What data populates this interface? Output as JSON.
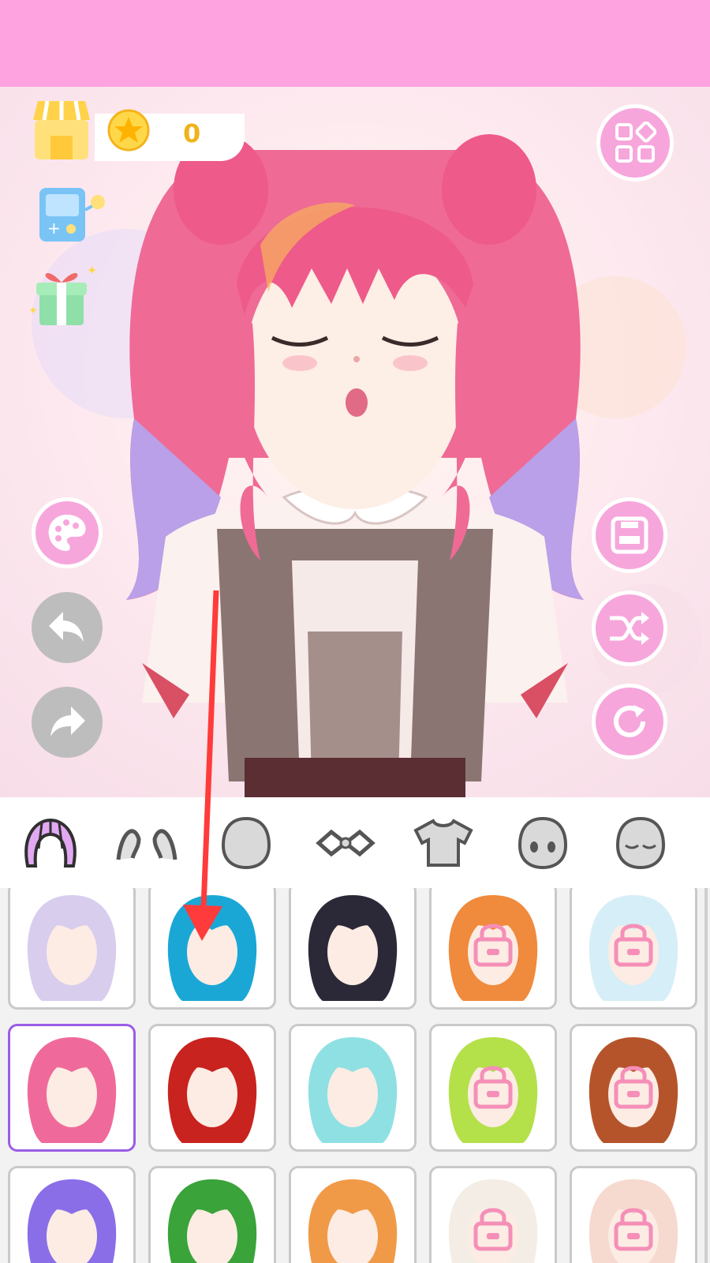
{
  "app": {
    "coins": "0",
    "colors": {
      "topbar": "#ffa3e0",
      "pink_button": "#f7a6dc",
      "grey_button": "#bdbdbd",
      "selected_border": "#9b5de5",
      "hair": "#ef5f8f",
      "annotation_arrow": "#ff3b3b"
    }
  },
  "side_buttons_left": [
    "shop-icon",
    "coin-icon",
    "game-icon",
    "gift-icon",
    "palette-icon",
    "undo-icon",
    "redo-icon"
  ],
  "side_buttons_right": [
    "grid-menu-icon",
    "save-icon",
    "shuffle-icon",
    "refresh-icon"
  ],
  "categories": [
    {
      "name": "hair",
      "icon": "hair-icon",
      "active": true
    },
    {
      "name": "ears",
      "icon": "ears-icon",
      "active": false
    },
    {
      "name": "head",
      "icon": "head-icon",
      "active": false
    },
    {
      "name": "accessory",
      "icon": "accessory-icon",
      "active": false
    },
    {
      "name": "clothes",
      "icon": "shirt-icon",
      "active": false
    },
    {
      "name": "eyes",
      "icon": "face-eyes-icon",
      "active": false
    },
    {
      "name": "expression",
      "icon": "face-closed-eyes-icon",
      "active": false
    }
  ],
  "hair_options": [
    {
      "color": "#d9cdee",
      "locked": false,
      "selected": false
    },
    {
      "color": "#1aa7d6",
      "locked": false,
      "selected": false
    },
    {
      "color": "#2b2838",
      "locked": false,
      "selected": false
    },
    {
      "color": "#f08a3c",
      "locked": true,
      "selected": false
    },
    {
      "color": "#d6eef7",
      "locked": true,
      "selected": false
    },
    {
      "color": "#ef6a9a",
      "locked": false,
      "selected": true
    },
    {
      "color": "#c8231e",
      "locked": false,
      "selected": false
    },
    {
      "color": "#8fe0e3",
      "locked": false,
      "selected": false
    },
    {
      "color": "#b4e04a",
      "locked": true,
      "selected": false
    },
    {
      "color": "#b5542b",
      "locked": true,
      "selected": false
    },
    {
      "color": "#8a6ee8",
      "locked": false,
      "selected": false
    },
    {
      "color": "#3aa33a",
      "locked": false,
      "selected": false
    },
    {
      "color": "#f09a48",
      "locked": false,
      "selected": false
    },
    {
      "color": "#f3ede6",
      "locked": true,
      "selected": false
    },
    {
      "color": "#f6d9cf",
      "locked": true,
      "selected": false
    }
  ]
}
